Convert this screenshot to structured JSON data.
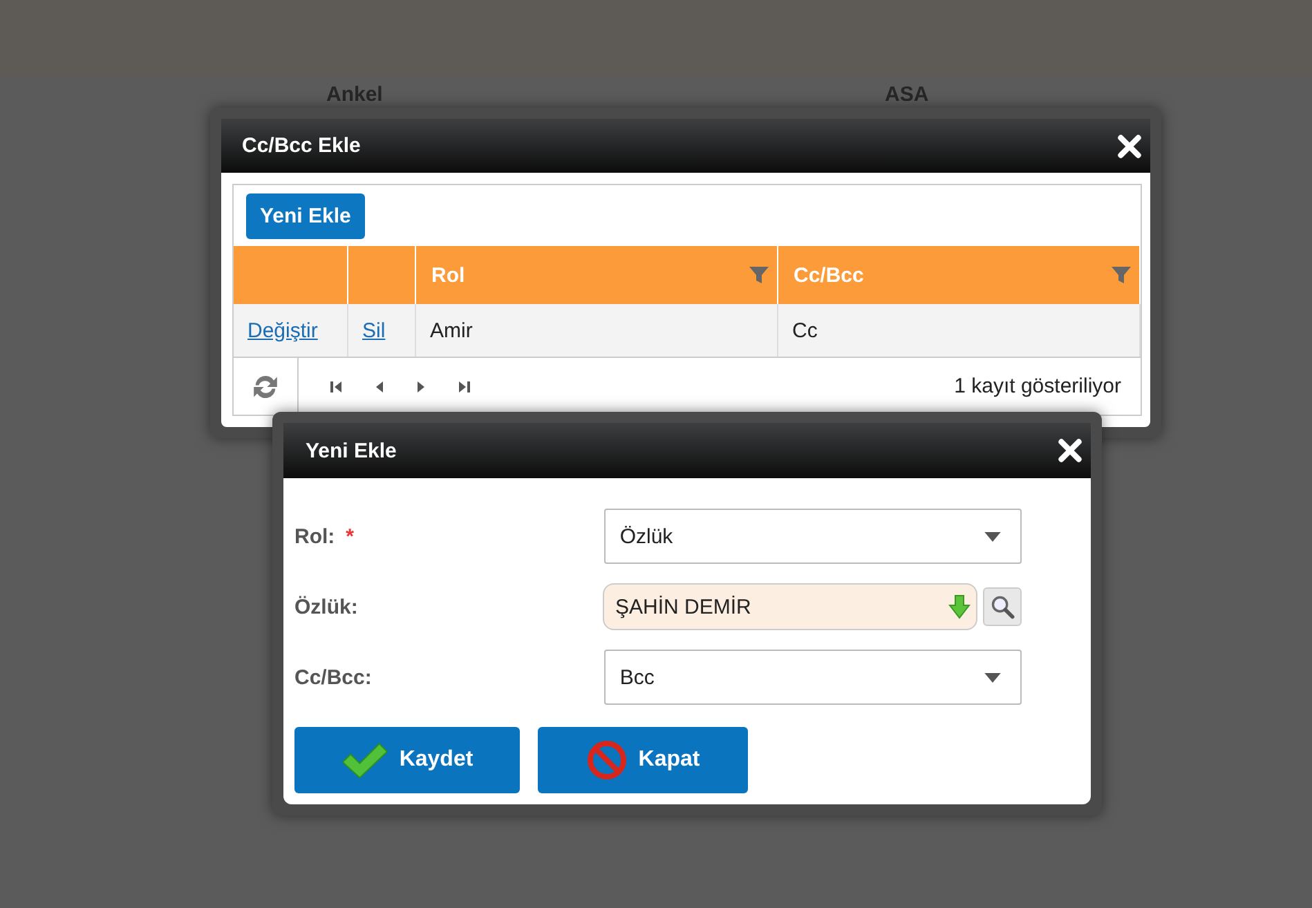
{
  "background": {
    "labels": [
      "Ankel",
      "ASA"
    ]
  },
  "list_dialog": {
    "title": "Cc/Bcc Ekle",
    "new_button": "Yeni Ekle",
    "columns": [
      {
        "label": "Rol"
      },
      {
        "label": "Cc/Bcc"
      }
    ],
    "rows": [
      {
        "edit": "Değiştir",
        "delete": "Sil",
        "cells": [
          "Amir",
          "Cc"
        ]
      }
    ],
    "pager_status": "1 kayıt gösteriliyor"
  },
  "form_dialog": {
    "title": "Yeni Ekle",
    "fields": [
      {
        "kind": "select",
        "label": "Rol:",
        "marker": "*",
        "value": "Özlük"
      },
      {
        "kind": "lookup",
        "label": "Özlük:",
        "value": "ŞAHİN DEMİR"
      },
      {
        "kind": "select",
        "label": "Cc/Bcc:",
        "value": "Bcc"
      }
    ],
    "buttons": [
      {
        "kind": "save",
        "label": "Kaydet"
      },
      {
        "kind": "close",
        "label": "Kapat"
      }
    ]
  }
}
